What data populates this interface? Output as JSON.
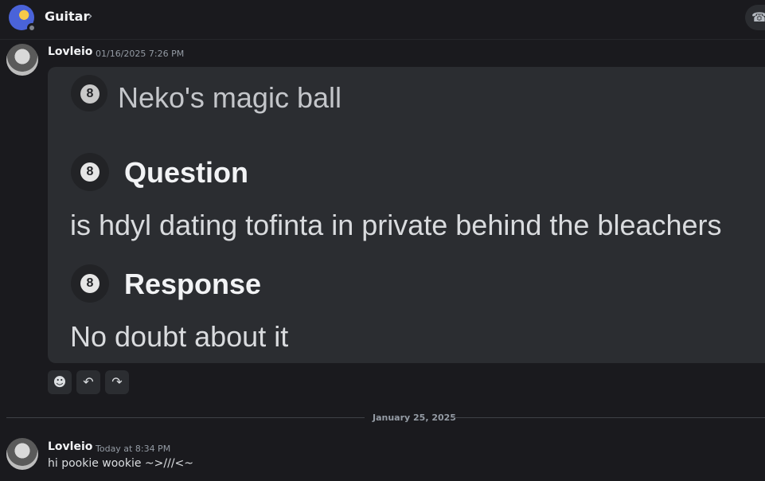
{
  "header": {
    "server_name": "Guitar",
    "chevron": "›",
    "call_icon": "phone-icon"
  },
  "messages": [
    {
      "username": "Lovleio",
      "timestamp": "01/16/2025 7:26 PM",
      "embed": {
        "author": "Neko's magic ball",
        "question_title": "Question",
        "question": "is hdyl dating tofinta in private behind the bleachers",
        "response_title": "Response",
        "response": "No doubt about it"
      },
      "actions": {
        "react_icon": "☻",
        "reply_icon": "↶",
        "forward_icon": "↷"
      }
    },
    {
      "username": "Lovleio",
      "timestamp": "Today at 8:34 PM",
      "text": "hi pookie wookie ~>///<~"
    }
  ],
  "date_divider": "January 25, 2025"
}
